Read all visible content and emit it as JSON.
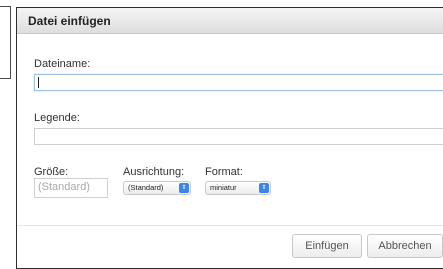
{
  "dialog": {
    "title": "Datei einfügen",
    "close_glyph": "×"
  },
  "form": {
    "filename": {
      "label": "Dateiname:",
      "value": ""
    },
    "legend": {
      "label": "Legende:",
      "value": ""
    },
    "size": {
      "label": "Größe:",
      "placeholder": "(Standard)"
    },
    "alignment": {
      "label": "Ausrichtung:",
      "selected": "(Standard)"
    },
    "format": {
      "label": "Format:",
      "selected": "miniatur"
    }
  },
  "buttons": {
    "insert": "Einfügen",
    "cancel": "Abbrechen"
  },
  "colors": {
    "select_arrow": "#3b84e8",
    "focus_border": "#9fc3e6"
  }
}
